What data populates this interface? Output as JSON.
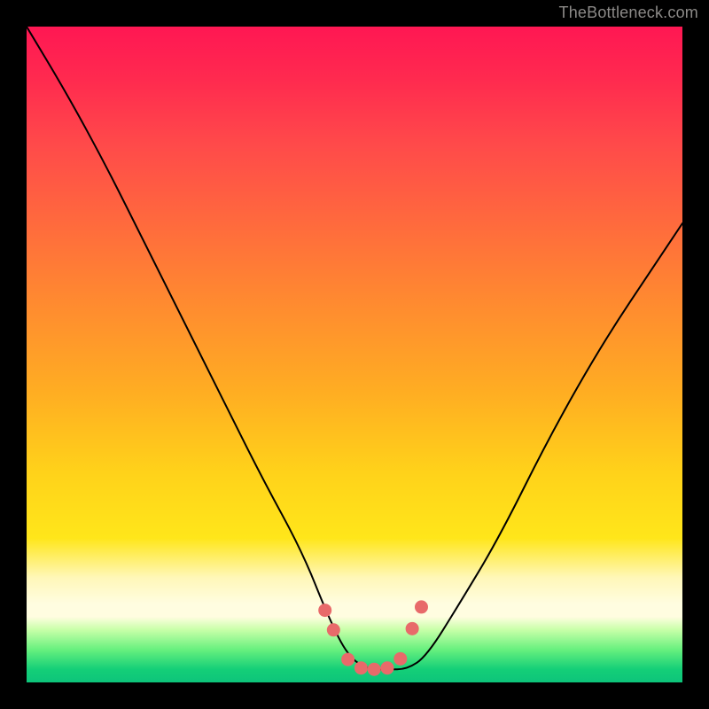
{
  "watermark": "TheBottleneck.com",
  "colors": {
    "frame": "#000000",
    "curve": "#000000",
    "marker": "#e86a6a",
    "gradient_top": "#ff1753",
    "gradient_mid": "#ffd21a",
    "gradient_bottom": "#0dc47a"
  },
  "chart_data": {
    "type": "line",
    "title": "",
    "xlabel": "",
    "ylabel": "",
    "xlim": [
      0,
      100
    ],
    "ylim": [
      0,
      100
    ],
    "note": "x is normalized horizontal position (0=left plot edge, 100=right). y is normalized vertical position (0=bottom green band, 100=top pink edge). Values estimated from pixel positions; no axes/ticks are shown in the image.",
    "series": [
      {
        "name": "bottleneck-curve",
        "x": [
          0,
          6,
          12,
          18,
          24,
          30,
          36,
          42,
          46,
          49,
          52,
          55,
          58,
          61,
          66,
          72,
          80,
          88,
          96,
          100
        ],
        "y": [
          100,
          90,
          79,
          67,
          55,
          43,
          31,
          20,
          10,
          4,
          2,
          2,
          2,
          4,
          12,
          22,
          38,
          52,
          64,
          70
        ]
      }
    ],
    "markers": {
      "name": "highlight-points",
      "x": [
        45.5,
        46.8,
        49.0,
        51.0,
        53.0,
        55.0,
        57.0,
        58.8,
        60.2
      ],
      "y": [
        11.0,
        8.0,
        3.5,
        2.2,
        2.0,
        2.2,
        3.6,
        8.2,
        11.5
      ]
    }
  }
}
